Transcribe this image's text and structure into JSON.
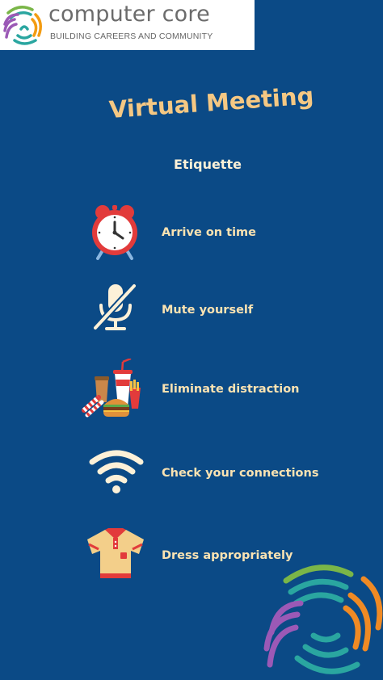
{
  "brand": {
    "name": "computer core",
    "tagline": "BUILDING CAREERS AND COMMUNITY"
  },
  "title": "Virtual Meeting",
  "subtitle": "Etiquette",
  "items": [
    {
      "label": "Arrive on time",
      "icon": "alarm-clock-icon"
    },
    {
      "label": "Mute yourself",
      "icon": "muted-microphone-icon"
    },
    {
      "label": "Eliminate distraction",
      "icon": "fast-food-icon"
    },
    {
      "label": "Check your connections",
      "icon": "wifi-icon"
    },
    {
      "label": "Dress appropriately",
      "icon": "polo-shirt-icon"
    }
  ],
  "colors": {
    "background": "#0b4a86",
    "title": "#f5c883",
    "label": "#fbe3b2",
    "icon_cream": "#fdf1d8"
  }
}
